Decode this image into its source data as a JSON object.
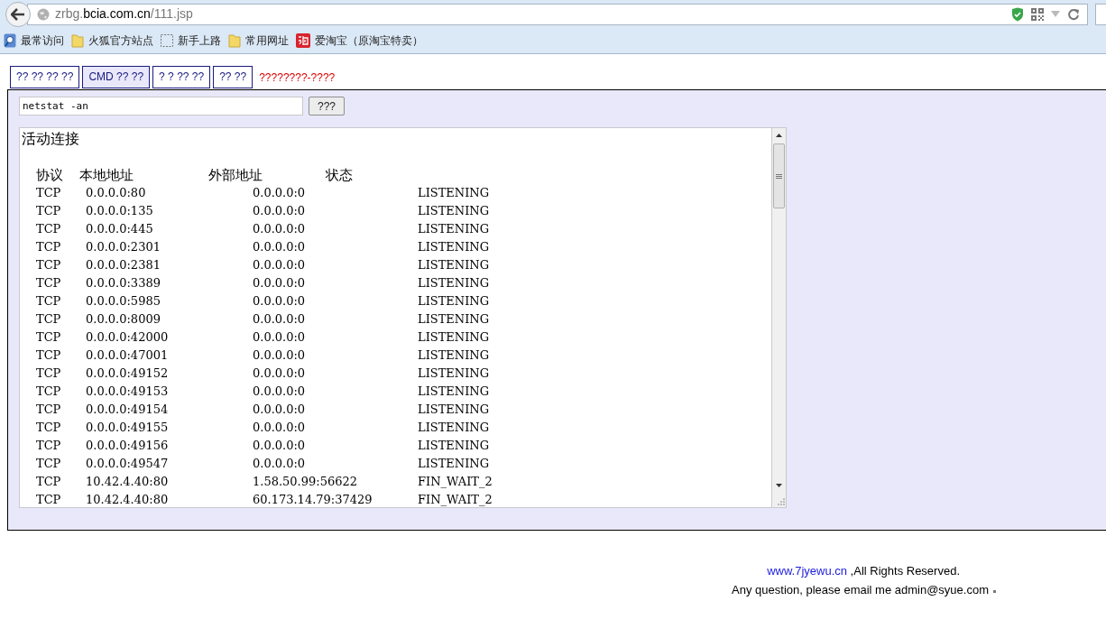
{
  "browser": {
    "url_host_prefix": "zrbg.",
    "url_host": "bcia.com.cn",
    "url_path": "/111.jsp",
    "bookmarks": [
      {
        "label": "最常访问",
        "kind": "magnifier"
      },
      {
        "label": "火狐官方站点",
        "kind": "folder"
      },
      {
        "label": "新手上路",
        "kind": "dotted"
      },
      {
        "label": "常用网址",
        "kind": "folder"
      },
      {
        "label": "爱淘宝（原淘宝特卖）",
        "kind": "shop"
      }
    ]
  },
  "tabs": [
    {
      "label": "?? ?? ?? ??",
      "selected": false
    },
    {
      "label": "CMD ?? ??",
      "selected": true
    },
    {
      "label": "? ? ?? ??",
      "selected": false
    },
    {
      "label": "?? ??",
      "selected": false
    }
  ],
  "notice": "????????-????",
  "command": {
    "value": "netstat -an",
    "button": "???"
  },
  "output": {
    "title": "活动连接",
    "headers": [
      "协议",
      "本地地址",
      "外部地址",
      "状态"
    ],
    "rows": [
      [
        "TCP",
        "0.0.0.0:80",
        "0.0.0.0:0",
        "LISTENING"
      ],
      [
        "TCP",
        "0.0.0.0:135",
        "0.0.0.0:0",
        "LISTENING"
      ],
      [
        "TCP",
        "0.0.0.0:445",
        "0.0.0.0:0",
        "LISTENING"
      ],
      [
        "TCP",
        "0.0.0.0:2301",
        "0.0.0.0:0",
        "LISTENING"
      ],
      [
        "TCP",
        "0.0.0.0:2381",
        "0.0.0.0:0",
        "LISTENING"
      ],
      [
        "TCP",
        "0.0.0.0:3389",
        "0.0.0.0:0",
        "LISTENING"
      ],
      [
        "TCP",
        "0.0.0.0:5985",
        "0.0.0.0:0",
        "LISTENING"
      ],
      [
        "TCP",
        "0.0.0.0:8009",
        "0.0.0.0:0",
        "LISTENING"
      ],
      [
        "TCP",
        "0.0.0.0:42000",
        "0.0.0.0:0",
        "LISTENING"
      ],
      [
        "TCP",
        "0.0.0.0:47001",
        "0.0.0.0:0",
        "LISTENING"
      ],
      [
        "TCP",
        "0.0.0.0:49152",
        "0.0.0.0:0",
        "LISTENING"
      ],
      [
        "TCP",
        "0.0.0.0:49153",
        "0.0.0.0:0",
        "LISTENING"
      ],
      [
        "TCP",
        "0.0.0.0:49154",
        "0.0.0.0:0",
        "LISTENING"
      ],
      [
        "TCP",
        "0.0.0.0:49155",
        "0.0.0.0:0",
        "LISTENING"
      ],
      [
        "TCP",
        "0.0.0.0:49156",
        "0.0.0.0:0",
        "LISTENING"
      ],
      [
        "TCP",
        "0.0.0.0:49547",
        "0.0.0.0:0",
        "LISTENING"
      ],
      [
        "TCP",
        "10.42.4.40:80",
        "1.58.50.99:56622",
        "FIN_WAIT_2"
      ],
      [
        "TCP",
        "10.42.4.40:80",
        "60.173.14.79:37429",
        "FIN_WAIT_2"
      ]
    ]
  },
  "footer": {
    "link": "www.7jyewu.cn",
    "rights": " ,All Rights Reserved.",
    "contact": "Any question, please email me admin@syue.com"
  }
}
